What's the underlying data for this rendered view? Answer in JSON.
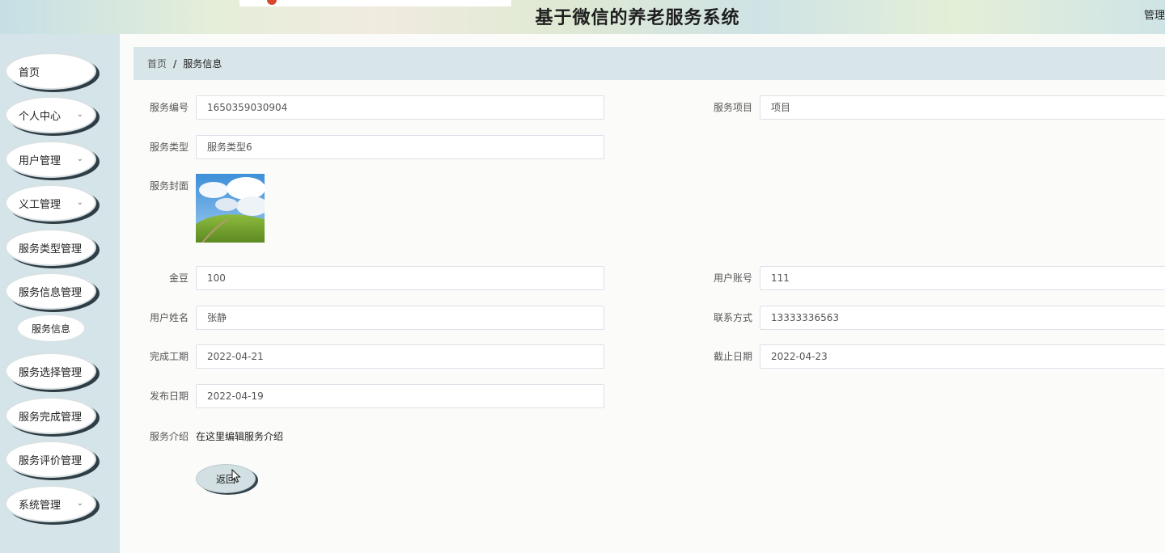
{
  "header": {
    "title": "基于微信的养老服务系统",
    "admin": "管理"
  },
  "sidebar": {
    "items": [
      {
        "label": "首页"
      },
      {
        "label": "个人中心",
        "chevron": "⌄"
      },
      {
        "label": "用户管理",
        "chevron": "⌄"
      },
      {
        "label": "义工管理",
        "chevron": "⌄"
      },
      {
        "label": "服务类型管理"
      },
      {
        "label": "服务信息管理"
      },
      {
        "label": "服务选择管理"
      },
      {
        "label": "服务完成管理"
      },
      {
        "label": "服务评价管理"
      },
      {
        "label": "系统管理",
        "chevron": "⌄"
      }
    ],
    "sub_item": "服务信息"
  },
  "breadcrumb": {
    "home": "首页",
    "separator": "/",
    "current": "服务信息"
  },
  "form": {
    "service_no": {
      "label": "服务编号",
      "value": "1650359030904"
    },
    "service_item": {
      "label": "服务项目",
      "value": "项目"
    },
    "service_type": {
      "label": "服务类型",
      "value": "服务类型6"
    },
    "service_cover": {
      "label": "服务封面"
    },
    "gold_beans": {
      "label": "金豆",
      "value": "100"
    },
    "user_account": {
      "label": "用户账号",
      "value": "111"
    },
    "user_name": {
      "label": "用户姓名",
      "value": "张静"
    },
    "contact": {
      "label": "联系方式",
      "value": "13333336563"
    },
    "complete_date": {
      "label": "完成工期",
      "value": "2022-04-21"
    },
    "deadline": {
      "label": "截止日期",
      "value": "2022-04-23"
    },
    "publish_date": {
      "label": "发布日期",
      "value": "2022-04-19"
    },
    "intro": {
      "label": "服务介绍",
      "value": "在这里编辑服务介绍"
    }
  },
  "buttons": {
    "back": "返回"
  },
  "colors": {
    "sidebar_bg": "#d4e4e8",
    "breadcrumb_bg": "#d8e6e9",
    "menu_shadow": "#2f3e46"
  }
}
